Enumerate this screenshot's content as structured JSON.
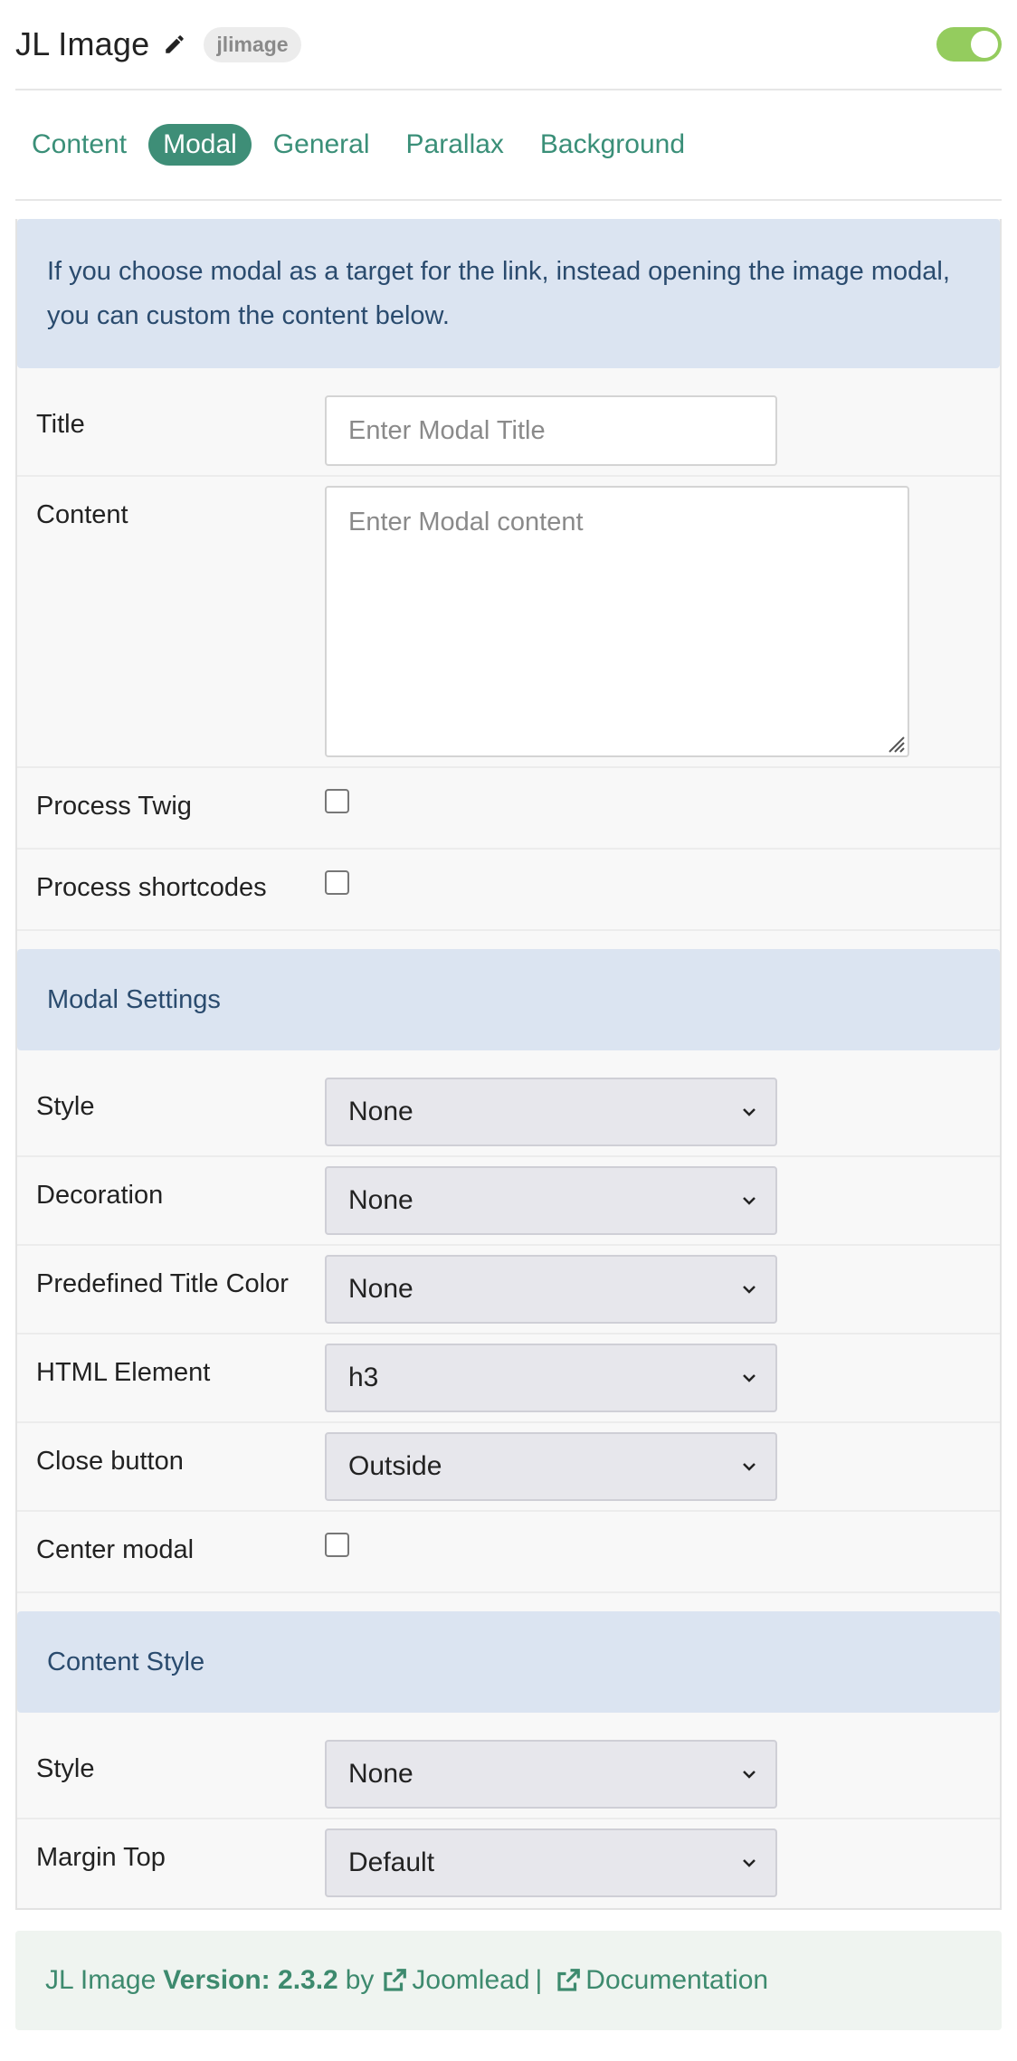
{
  "header": {
    "title": "JL Image",
    "slug": "jlimage",
    "enabled": true
  },
  "tabs": [
    {
      "label": "Content",
      "active": false
    },
    {
      "label": "Modal",
      "active": true
    },
    {
      "label": "General",
      "active": false
    },
    {
      "label": "Parallax",
      "active": false
    },
    {
      "label": "Background",
      "active": false
    }
  ],
  "alert": {
    "text": "If you choose modal as a target for the link, instead opening the image modal, you can custom the content below."
  },
  "fields": {
    "title": {
      "label": "Title",
      "value": "",
      "placeholder": "Enter Modal Title"
    },
    "content": {
      "label": "Content",
      "value": "",
      "placeholder": "Enter Modal content"
    },
    "process_twig": {
      "label": "Process Twig",
      "checked": false
    },
    "process_shortcodes": {
      "label": "Process shortcodes",
      "checked": false
    }
  },
  "modal_settings": {
    "heading": "Modal Settings",
    "style": {
      "label": "Style",
      "value": "None"
    },
    "decoration": {
      "label": "Decoration",
      "value": "None"
    },
    "title_color": {
      "label": "Predefined Title Color",
      "value": "None"
    },
    "html_element": {
      "label": "HTML Element",
      "value": "h3"
    },
    "close_button": {
      "label": "Close button",
      "value": "Outside"
    },
    "center_modal": {
      "label": "Center modal",
      "checked": false
    }
  },
  "content_style": {
    "heading": "Content Style",
    "style": {
      "label": "Style",
      "value": "None"
    },
    "margin_top": {
      "label": "Margin Top",
      "value": "Default"
    }
  },
  "footer": {
    "name": "JL Image",
    "version_label": "Version: 2.3.2",
    "by": "by",
    "author_link": "Joomlead",
    "separator": "|",
    "docs_link": "Documentation"
  },
  "colors": {
    "accent": "#3e8e77",
    "toggle_on": "#94cc5e",
    "info_bg": "#dbe4f1",
    "info_text": "#2a4b6e",
    "footer_bg": "#eff4f0"
  }
}
